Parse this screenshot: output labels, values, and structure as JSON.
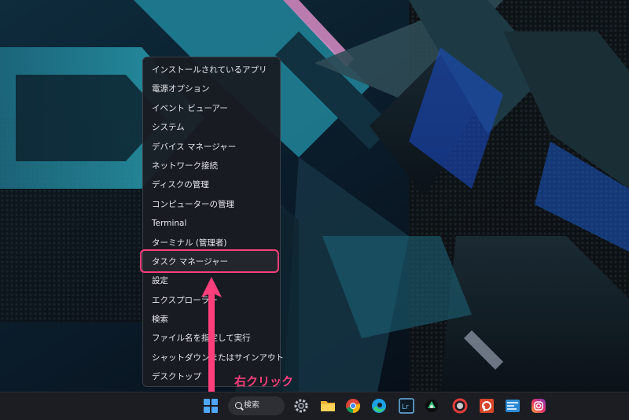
{
  "menu": {
    "items": [
      {
        "label": "インストールされているアプリ"
      },
      {
        "label": "電源オプション"
      },
      {
        "label": "イベント ビューアー"
      },
      {
        "label": "システム"
      },
      {
        "label": "デバイス マネージャー"
      },
      {
        "label": "ネットワーク接続"
      },
      {
        "label": "ディスクの管理"
      },
      {
        "label": "コンピューターの管理"
      },
      {
        "label": "Terminal"
      },
      {
        "label": "ターミナル (管理者)"
      },
      {
        "label": "タスク マネージャー"
      },
      {
        "label": "設定"
      },
      {
        "label": "エクスプローラー"
      },
      {
        "label": "検索"
      },
      {
        "label": "ファイル名を指定して実行"
      },
      {
        "label": "シャットダウンまたはサインアウト",
        "submenu_glyph": "›"
      },
      {
        "label": "デスクトップ"
      }
    ],
    "highlighted_index": 10
  },
  "annotation": {
    "label": "右クリック",
    "color": "#ff3f7c"
  },
  "taskbar": {
    "search_label": "検索",
    "icons": [
      "settings-icon",
      "file-explorer-icon",
      "chrome-icon",
      "edge-icon",
      "lightroom-icon",
      "app-icon",
      "app-icon",
      "app-icon",
      "powerpoint-icon",
      "code-icon",
      "instagram-icon"
    ]
  },
  "colors": {
    "accent_pink": "#ff3f7c",
    "start_blue": "#4ea6ff",
    "menu_bg": "#1a1c22",
    "taskbar_bg": "#1c1d22"
  }
}
